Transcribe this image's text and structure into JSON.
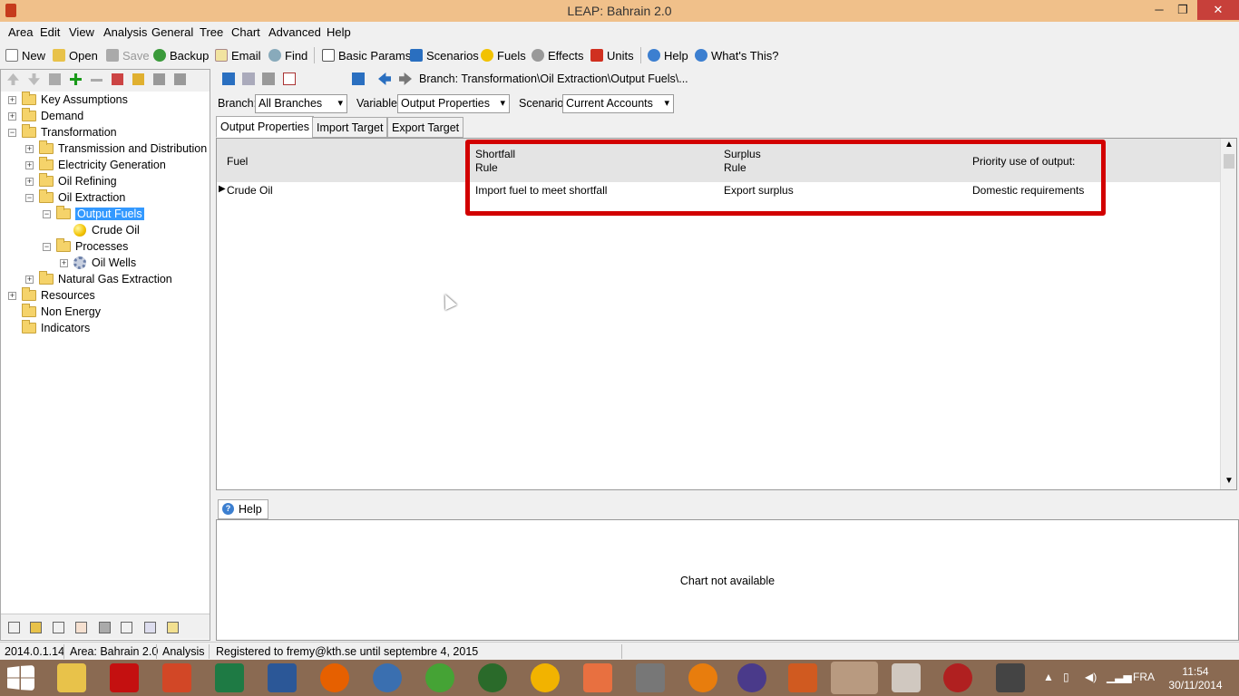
{
  "window": {
    "title": "LEAP: Bahrain 2.0",
    "minimize": "─",
    "maximize": "❐",
    "close": "✕"
  },
  "menu": [
    "Area",
    "Edit",
    "View",
    "Analysis",
    "General",
    "Tree",
    "Chart",
    "Advanced",
    "Help"
  ],
  "toolbar": {
    "new": "New",
    "open": "Open",
    "save": "Save",
    "backup": "Backup",
    "email": "Email",
    "find": "Find",
    "basic_params": "Basic Params",
    "scenarios": "Scenarios",
    "fuels": "Fuels",
    "effects": "Effects",
    "units": "Units",
    "help": "Help",
    "whats_this": "What's This?"
  },
  "tree": {
    "key_assumptions": "Key Assumptions",
    "demand": "Demand",
    "transformation": "Transformation",
    "transmission": "Transmission and Distribution",
    "electricity": "Electricity Generation",
    "oil_refining": "Oil Refining",
    "oil_extraction": "Oil Extraction",
    "output_fuels": "Output Fuels",
    "crude_oil": "Crude Oil",
    "processes": "Processes",
    "oil_wells": "Oil Wells",
    "natural_gas": "Natural Gas Extraction",
    "resources": "Resources",
    "non_energy": "Non Energy",
    "indicators": "Indicators"
  },
  "breadcrumb": "Branch: Transformation\\Oil Extraction\\Output Fuels\\...",
  "filters": {
    "branch_label": "Branch:",
    "branch_value": "All Branches",
    "variable_label": "Variable:",
    "variable_value": "Output Properties",
    "scenario_label": "Scenario:",
    "scenario_value": "Current Accounts"
  },
  "tabs": [
    "Output Properties",
    "Import Target",
    "Export Target"
  ],
  "grid": {
    "headers": {
      "fuel": "Fuel",
      "shortfall_1": "Shortfall",
      "shortfall_2": "Rule",
      "surplus_1": "Surplus",
      "surplus_2": "Rule",
      "priority": "Priority use of output:"
    },
    "row": {
      "fuel": "Crude Oil",
      "shortfall": "Import fuel to meet shortfall",
      "surplus": "Export surplus",
      "priority": "Domestic requirements"
    }
  },
  "help": {
    "tab": "Help",
    "message": "Chart not available"
  },
  "status": {
    "version": "2014.0.1.14",
    "area": "Area: Bahrain 2.0",
    "view": "Analysis",
    "registration": "Registered to fremy@kth.se until septembre 4, 2015"
  },
  "taskbar": {
    "lang": "FRA",
    "time": "11:54",
    "date": "30/11/2014"
  }
}
